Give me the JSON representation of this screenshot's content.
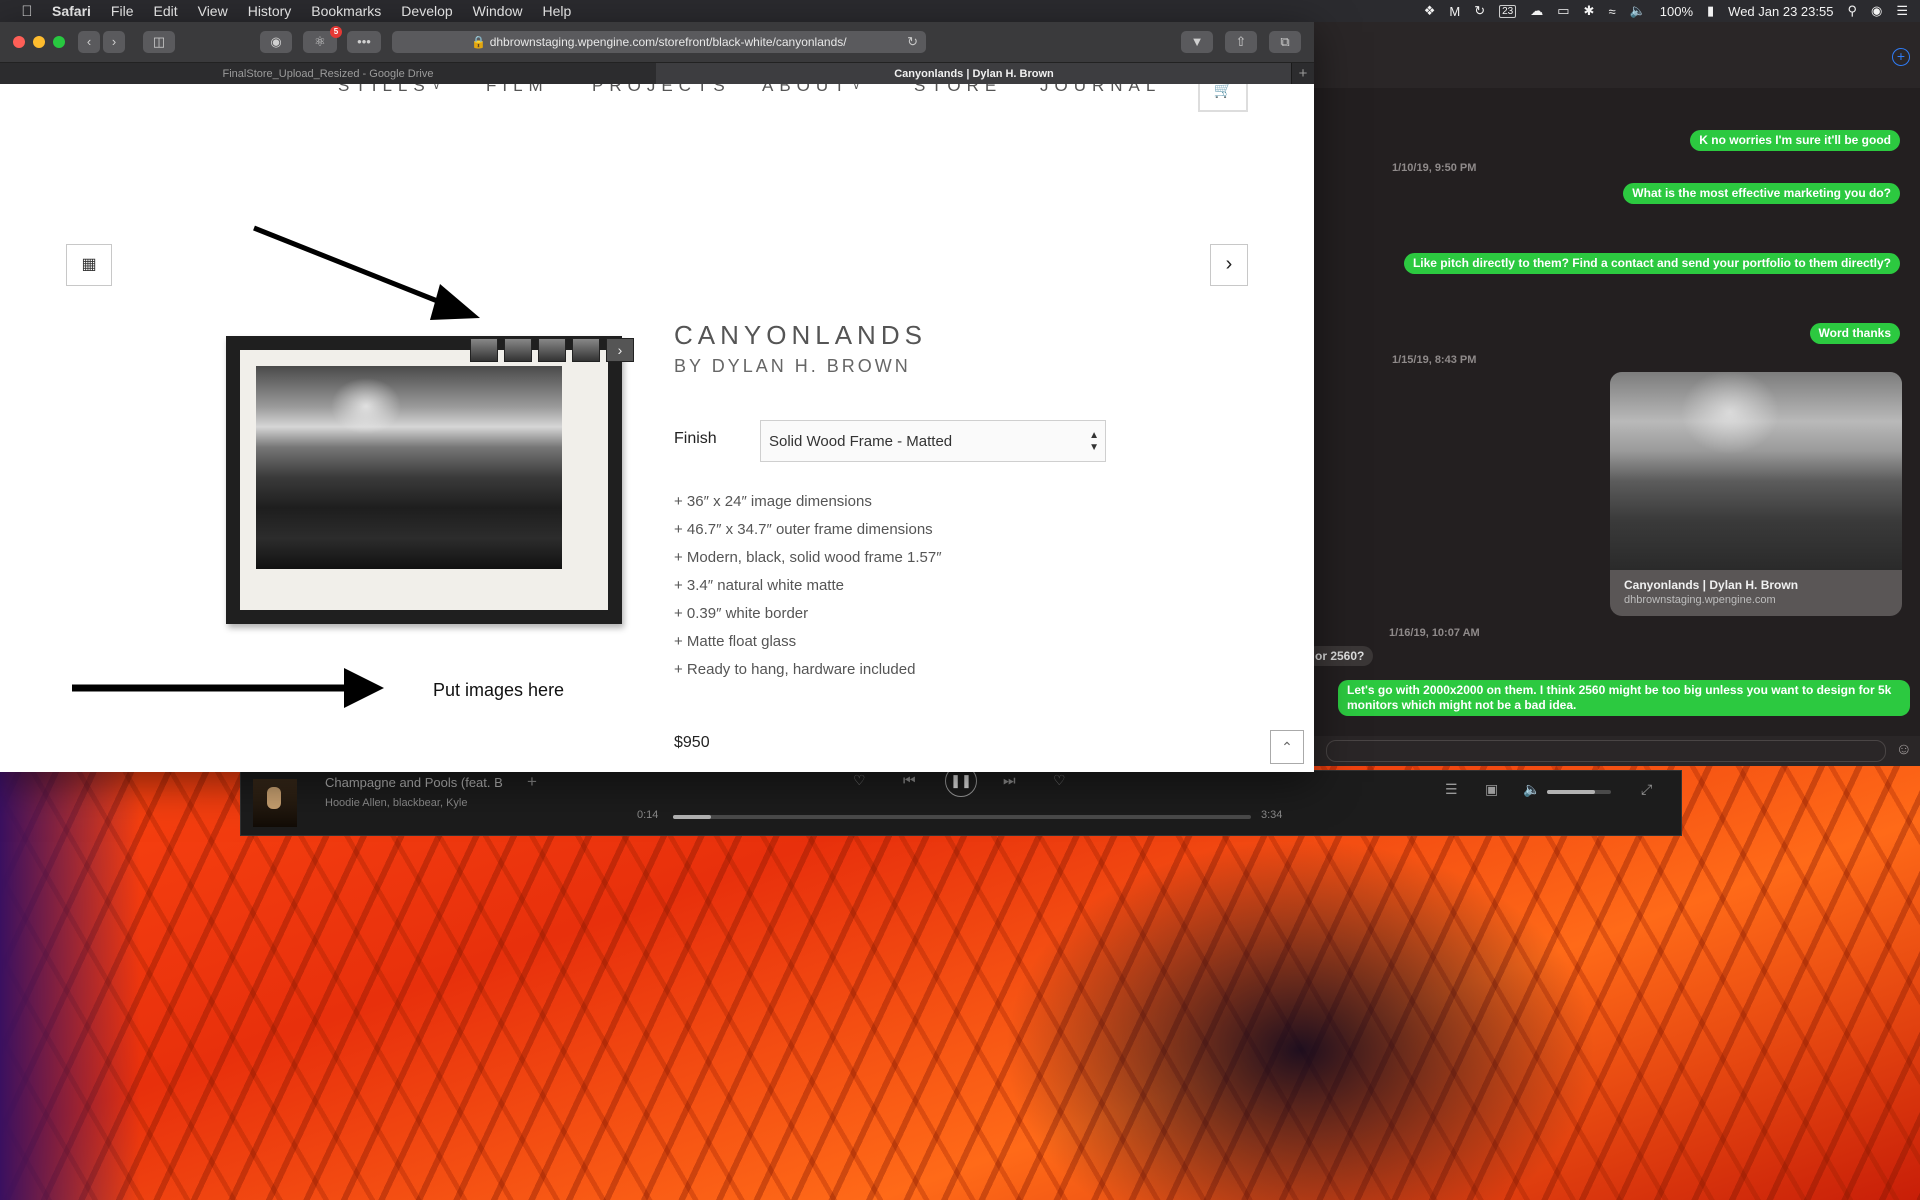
{
  "menubar": {
    "app": "Safari",
    "items": [
      "File",
      "Edit",
      "View",
      "History",
      "Bookmarks",
      "Develop",
      "Window",
      "Help"
    ],
    "status": {
      "calendar_day": "23",
      "battery": "100%",
      "datetime": "Wed Jan 23  23:55"
    }
  },
  "safari": {
    "address": "dhbrownstaging.wpengine.com/storefront/black-white/canyonlands/",
    "extension_badge": "5",
    "tabs": [
      {
        "label": "FinalStore_Upload_Resized - Google Drive",
        "active": false
      },
      {
        "label": "Canyonlands | Dylan H. Brown",
        "active": true
      }
    ]
  },
  "site": {
    "nav": [
      {
        "label": "STILLS",
        "has_dropdown": true
      },
      {
        "label": "FILM",
        "has_dropdown": false
      },
      {
        "label": "PROJECTS",
        "has_dropdown": false
      },
      {
        "label": "ABOUT",
        "has_dropdown": true
      },
      {
        "label": "STORE",
        "has_dropdown": false
      },
      {
        "label": "JOURNAL",
        "has_dropdown": false
      }
    ],
    "product": {
      "title": "CANYONLANDS",
      "artist": "BY DYLAN H. BROWN",
      "finish_label": "Finish",
      "finish_value": "Solid Wood Frame - Matted",
      "features": [
        "+ 36″ x 24″ image dimensions",
        "+ 46.7″ x 34.7″ outer frame dimensions",
        "+ Modern, black, solid wood frame 1.57″",
        "+ 3.4″ natural white matte",
        "+ 0.39″ white border",
        "+ Matte float glass",
        "+ Ready to hang, hardware included"
      ],
      "price": "$950"
    },
    "annotation_text": "Put images here"
  },
  "messages": {
    "items": [
      {
        "kind": "sent",
        "text": "K no worries I'm sure it'll be good"
      },
      {
        "kind": "timestamp",
        "text": "1/10/19, 9:50 PM"
      },
      {
        "kind": "sent",
        "text": "What is the most effective marketing you do?"
      },
      {
        "kind": "sent",
        "text": "Like pitch directly to them? Find a contact and send your portfolio to them directly?"
      },
      {
        "kind": "sent",
        "text": "Word thanks"
      },
      {
        "kind": "timestamp",
        "text": "1/15/19, 8:43 PM"
      },
      {
        "kind": "timestamp",
        "text": "1/16/19, 10:07 AM"
      },
      {
        "kind": "received",
        "text": "or 2560?"
      },
      {
        "kind": "sent",
        "text": "Let's go with 2000x2000 on them. I think 2560 might be too big unless you want to design for 5k monitors which might not be a bad idea."
      }
    ],
    "link_card": {
      "title": "Canyonlands | Dylan H. Brown",
      "domain": "dhbrownstaging.wpengine.com"
    }
  },
  "music": {
    "song": "Champagne and Pools (feat. B",
    "artist": "Hoodie Allen, blackbear, Kyle",
    "elapsed": "0:14",
    "duration": "3:34",
    "progress": 0.065,
    "volume": 0.75
  }
}
